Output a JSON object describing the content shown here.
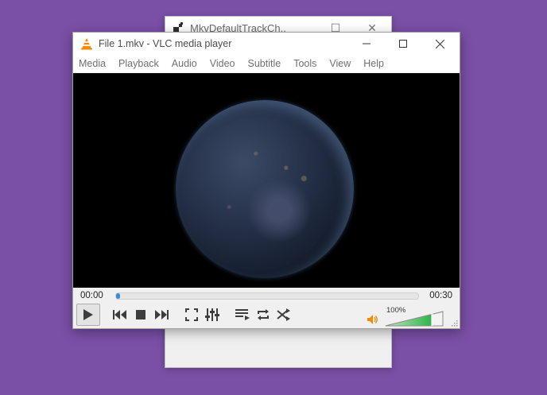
{
  "background_window": {
    "title": "MkvDefaultTrackCh...",
    "maximize_glyph": "☐",
    "close_glyph": "✕"
  },
  "window": {
    "title": "File 1.mkv - VLC media player",
    "icon": "vlc-cone-icon"
  },
  "menu": [
    {
      "label": "Media"
    },
    {
      "label": "Playback"
    },
    {
      "label": "Audio"
    },
    {
      "label": "Video"
    },
    {
      "label": "Subtitle"
    },
    {
      "label": "Tools"
    },
    {
      "label": "View"
    },
    {
      "label": "Help"
    }
  ],
  "playback": {
    "current_time": "00:00",
    "total_time": "00:30",
    "progress_fraction": 0.01
  },
  "volume": {
    "label": "100%",
    "level_fraction": 1.0
  },
  "colors": {
    "desktop": "#7a4fa6",
    "accent_cone": "#f48b00",
    "seek_fill": "#3a8be0",
    "volume_green": "#2fb34a"
  }
}
